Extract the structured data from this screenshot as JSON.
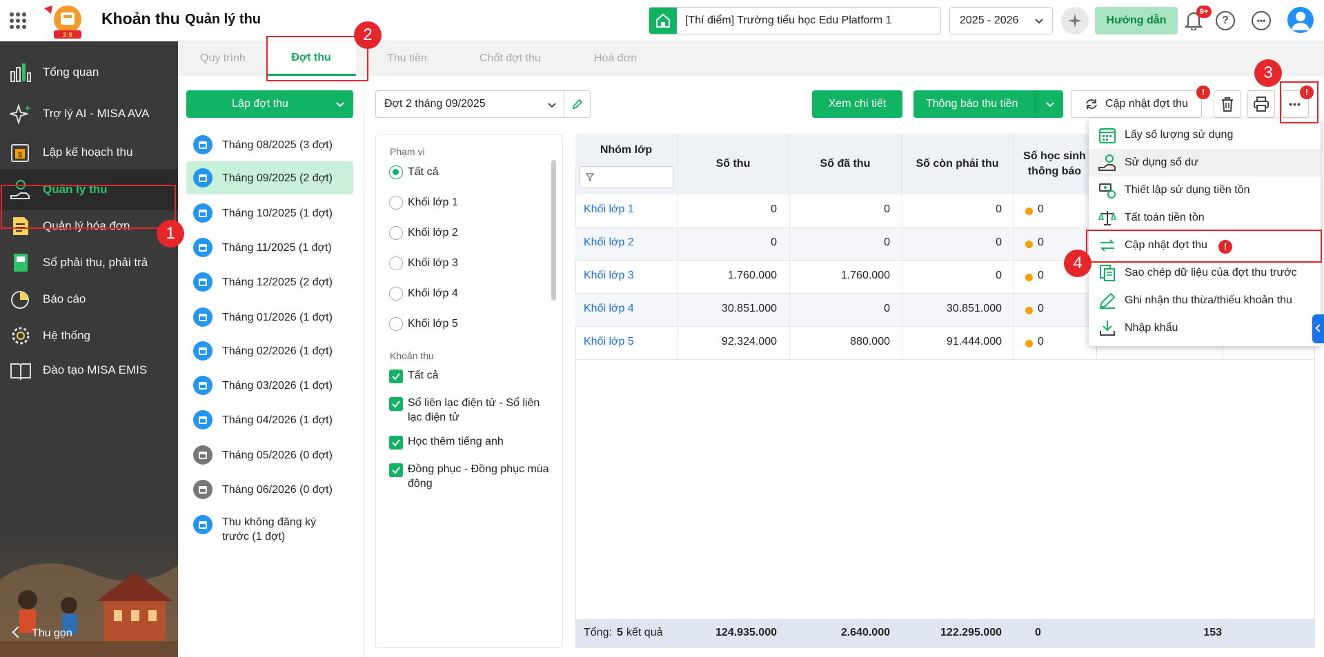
{
  "header": {
    "app_name": "Khoản thu",
    "page_title": "Quản lý thu",
    "school": "[Thí điểm] Trường tiểu học Edu Platform 1",
    "school_year": "2025 - 2026",
    "guide_label": "Hướng dẫn",
    "notification_count": "9+",
    "logo_text": "2.9"
  },
  "sidebar": {
    "items": [
      {
        "label": "Tổng quan",
        "icon": "chart-bars-icon"
      },
      {
        "label": "Trợ lý AI - MISA AVA",
        "icon": "sparkle-icon"
      },
      {
        "label": "Lập kế hoạch thu",
        "icon": "calendar-money-icon"
      },
      {
        "label": "Quản lý thu",
        "icon": "hand-coin-icon"
      },
      {
        "label": "Quản lý hóa đơn",
        "icon": "invoice-icon"
      },
      {
        "label": "Sổ phải thu, phải trả",
        "icon": "ledger-icon"
      },
      {
        "label": "Báo cáo",
        "icon": "pie-chart-icon"
      },
      {
        "label": "Hệ thống",
        "icon": "gear-icon"
      },
      {
        "label": "Đào tạo MISA EMIS",
        "icon": "book-icon"
      }
    ],
    "collapse_label": "Thu gọn"
  },
  "tabs": [
    "Quy trình",
    "Đợt thu",
    "Thu tiền",
    "Chốt đợt thu",
    "Hoá đơn"
  ],
  "create_button": "Lập đợt thu",
  "months": [
    {
      "label": "Tháng 08/2025 (3 đợt)",
      "color": "#2196f3"
    },
    {
      "label": "Tháng 09/2025 (2 đợt)",
      "color": "#2196f3"
    },
    {
      "label": "Tháng 10/2025 (1 đợt)",
      "color": "#2196f3"
    },
    {
      "label": "Tháng 11/2025 (1 đợt)",
      "color": "#2196f3"
    },
    {
      "label": "Tháng 12/2025 (2 đợt)",
      "color": "#2196f3"
    },
    {
      "label": "Tháng 01/2026 (1 đợt)",
      "color": "#2196f3"
    },
    {
      "label": "Tháng 02/2026 (1 đợt)",
      "color": "#2196f3"
    },
    {
      "label": "Tháng 03/2026 (1 đợt)",
      "color": "#2196f3"
    },
    {
      "label": "Tháng 04/2026 (1 đợt)",
      "color": "#2196f3"
    },
    {
      "label": "Tháng 05/2026 (0 đợt)",
      "color": "#777777"
    },
    {
      "label": "Tháng 06/2026 (0 đợt)",
      "color": "#777777"
    },
    {
      "label": "Thu không đăng ký trước (1 đợt)",
      "color": "#2196f3"
    }
  ],
  "period_select": "Đợt 2 tháng 09/2025",
  "filters": {
    "scope_title": "Phạm vi",
    "scope_options": [
      "Tất cả",
      "Khối lớp 1",
      "Khối lớp 2",
      "Khối lớp 3",
      "Khối lớp 4",
      "Khối lớp 5"
    ],
    "fee_title": "Khoản thu",
    "fee_options": [
      "Tất cả",
      "Sổ liên lạc điện tử - Sổ liên lạc điện tử",
      "Học thêm tiếng anh",
      "Đồng phục - Đồng phục mùa đông"
    ]
  },
  "toolbar": {
    "view_detail": "Xem chi tiết",
    "notify": "Thông báo thu tiền",
    "update": "Cập nhật đợt thu",
    "warn": "!"
  },
  "table": {
    "headers": [
      "Nhóm lớp",
      "Số thu",
      "Số đã thu",
      "Số còn phải thu",
      "Số học sinh thông báo"
    ],
    "rows": [
      {
        "group": "Khối lớp 1",
        "so_thu": "0",
        "da_thu": "0",
        "con_phai_thu": "0",
        "hs": "0"
      },
      {
        "group": "Khối lớp 2",
        "so_thu": "0",
        "da_thu": "0",
        "con_phai_thu": "0",
        "hs": "0"
      },
      {
        "group": "Khối lớp 3",
        "so_thu": "1.760.000",
        "da_thu": "1.760.000",
        "con_phai_thu": "0",
        "hs": "0"
      },
      {
        "group": "Khối lớp 4",
        "so_thu": "30.851.000",
        "da_thu": "0",
        "con_phai_thu": "30.851.000",
        "hs": "0"
      },
      {
        "group": "Khối lớp 5",
        "so_thu": "92.324.000",
        "da_thu": "880.000",
        "con_phai_thu": "91.444.000",
        "hs": "0"
      }
    ],
    "footer": {
      "label": "Tổng:",
      "count": "5",
      "suffix": "kết quả",
      "so_thu": "124.935.000",
      "da_thu": "2.640.000",
      "con_phai_thu": "122.295.000",
      "hs": "0",
      "last": "153"
    }
  },
  "menu": [
    {
      "label": "Lấy số lượng sử dụng",
      "icon": "calendar-grid-icon"
    },
    {
      "label": "Sử dụng số dư",
      "icon": "hand-dollar-icon"
    },
    {
      "label": "Thiết lập sử dụng tiền tồn",
      "icon": "money-settings-icon"
    },
    {
      "label": "Tất toán tiền tồn",
      "icon": "scale-icon"
    },
    {
      "label": "Cập nhật đợt thu",
      "icon": "swap-arrows-icon"
    },
    {
      "label": "Sao chép dữ liệu của đợt thu trước",
      "icon": "copy-doc-icon"
    },
    {
      "label": "Ghi nhận thu thừa/thiếu khoản thu",
      "icon": "pencil-icon"
    },
    {
      "label": "Nhập khẩu",
      "icon": "download-icon"
    }
  ],
  "annotations": [
    "1",
    "2",
    "3",
    "4"
  ],
  "colors": {
    "brand_green": "#10b463",
    "link_blue": "#1a73e8",
    "annotation_red": "#e5262b"
  }
}
